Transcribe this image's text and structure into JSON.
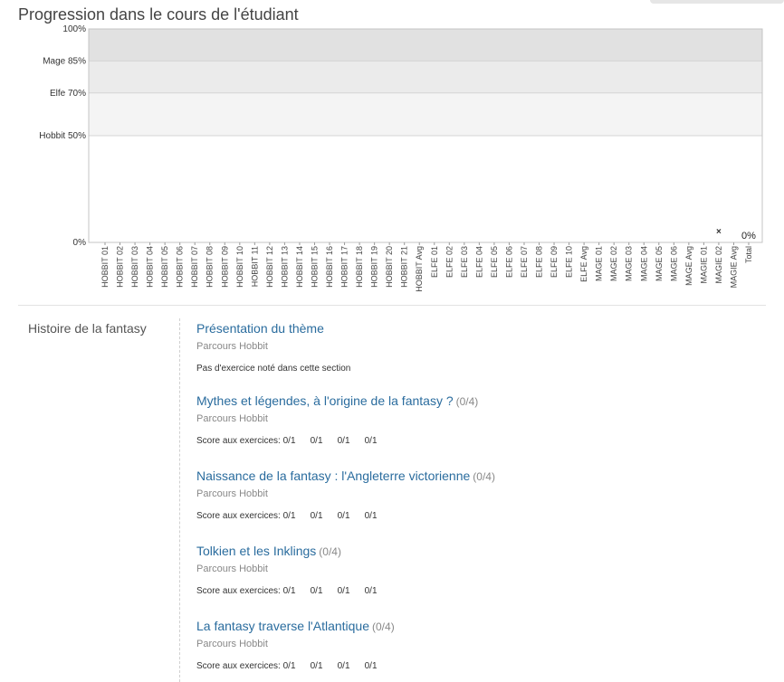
{
  "page": {
    "title": "Progression dans le cours de l'étudiant"
  },
  "chart_data": {
    "type": "bar",
    "categories": [
      "HOBBIT 01",
      "HOBBIT 02",
      "HOBBIT 03",
      "HOBBIT 04",
      "HOBBIT 05",
      "HOBBIT 06",
      "HOBBIT 07",
      "HOBBIT 08",
      "HOBBIT 09",
      "HOBBIT 10",
      "HOBBIT 11",
      "HOBBIT 12",
      "HOBBIT 13",
      "HOBBIT 14",
      "HOBBIT 15",
      "HOBBIT 16",
      "HOBBIT 17",
      "HOBBIT 18",
      "HOBBIT 19",
      "HOBBIT 20",
      "HOBBIT 21",
      "HOBBIT Avg",
      "ELFE 01",
      "ELFE 02",
      "ELFE 03",
      "ELFE 04",
      "ELFE 05",
      "ELFE 06",
      "ELFE 07",
      "ELFE 08",
      "ELFE 09",
      "ELFE 10",
      "ELFE Avg",
      "MAGE 01",
      "MAGE 02",
      "MAGE 03",
      "MAGE 04",
      "MAGE 05",
      "MAGE 06",
      "MAGE Avg",
      "MAGIE 01",
      "MAGIE 02",
      "MAGIE Avg",
      "Total"
    ],
    "values": [
      0,
      0,
      0,
      0,
      0,
      0,
      0,
      0,
      0,
      0,
      0,
      0,
      0,
      0,
      0,
      0,
      0,
      0,
      0,
      0,
      0,
      0,
      0,
      0,
      0,
      0,
      0,
      0,
      0,
      0,
      0,
      0,
      0,
      0,
      0,
      0,
      0,
      0,
      0,
      0,
      0,
      0,
      0,
      0
    ],
    "ylim": [
      0,
      100
    ],
    "y_ticks": [
      {
        "value": 0,
        "label": "0%"
      },
      {
        "value": 50,
        "label": "Hobbit 50%"
      },
      {
        "value": 70,
        "label": "Elfe 70%"
      },
      {
        "value": 85,
        "label": "Mage 85%"
      },
      {
        "value": 100,
        "label": "100%"
      }
    ],
    "bands": [
      {
        "from": 50,
        "to": 70,
        "color": "#f4f4f4"
      },
      {
        "from": 70,
        "to": 85,
        "color": "#ebebeb"
      },
      {
        "from": 85,
        "to": 100,
        "color": "#e1e1e1"
      }
    ],
    "marker": {
      "category": "MAGIE 02",
      "symbol": "×"
    },
    "total_label": "0%",
    "grid": false
  },
  "chapter": {
    "name": "Histoire de la fantasy",
    "sections": [
      {
        "title": "Présentation du thème",
        "total": "",
        "format": "Parcours Hobbit",
        "note": "Pas d'exercice noté dans cette section",
        "score_label": "",
        "scores": []
      },
      {
        "title": "Mythes et légendes, à l'origine de la fantasy ?",
        "total": "(0/4)",
        "format": "Parcours Hobbit",
        "note": "",
        "score_label": "Score aux exercices:",
        "scores": [
          "0/1",
          "0/1",
          "0/1",
          "0/1"
        ]
      },
      {
        "title": "Naissance de la fantasy : l'Angleterre victorienne",
        "total": "(0/4)",
        "format": "Parcours Hobbit",
        "note": "",
        "score_label": "Score aux exercices:",
        "scores": [
          "0/1",
          "0/1",
          "0/1",
          "0/1"
        ]
      },
      {
        "title": "Tolkien et les Inklings",
        "total": "(0/4)",
        "format": "Parcours Hobbit",
        "note": "",
        "score_label": "Score aux exercices:",
        "scores": [
          "0/1",
          "0/1",
          "0/1",
          "0/1"
        ]
      },
      {
        "title": "La fantasy traverse l'Atlantique",
        "total": "(0/4)",
        "format": "Parcours Hobbit",
        "note": "",
        "score_label": "Score aux exercices:",
        "scores": [
          "0/1",
          "0/1",
          "0/1",
          "0/1"
        ]
      }
    ]
  }
}
